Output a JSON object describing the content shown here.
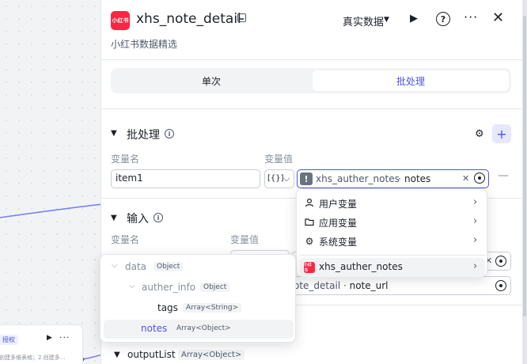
{
  "canvas": {
    "node": {
      "badge": "授权",
      "description": "创建多维表格；2.创建多…"
    }
  },
  "header": {
    "logo_text": "小红书",
    "title": "xhs_note_detail",
    "subtitle": "小红书数据精选",
    "mode_label": "真实数据",
    "icons": [
      "edit-icon",
      "chevron-down-icon",
      "play-icon",
      "help-icon",
      "more-icon",
      "close-icon"
    ]
  },
  "tabs": {
    "single": "单次",
    "batch": "批处理",
    "active": "batch"
  },
  "batch_section": {
    "title": "批处理",
    "col_name": "变量名",
    "col_value": "变量值",
    "row": {
      "name": "item1",
      "type_icon": "[{}]",
      "ref_node": "xhs_auther_notes",
      "ref_field": "notes"
    }
  },
  "input_section": {
    "title": "输入",
    "col_name": "变量名",
    "col_value": "变量值",
    "rows": [
      {
        "ref_text": ""
      },
      {
        "ref_node": "ote_detail",
        "ref_field": "note_url"
      }
    ]
  },
  "output_section": {
    "name": "outputList",
    "type": "Array<Object>"
  },
  "variable_menu": {
    "items": [
      {
        "label": "用户变量",
        "icon": "user-icon"
      },
      {
        "label": "应用变量",
        "icon": "folder-icon"
      },
      {
        "label": "系统变量",
        "icon": "gear-icon"
      },
      {
        "label": "xhs_auther_notes",
        "icon": "xiaohongshu-logo-icon"
      }
    ]
  },
  "field_tree": {
    "rows": [
      {
        "name": "data",
        "type": "Object"
      },
      {
        "name": "auther_info",
        "type": "Object"
      },
      {
        "name": "tags",
        "type": "Array<String>"
      },
      {
        "name": "notes",
        "type": "Array<Object>"
      }
    ]
  }
}
